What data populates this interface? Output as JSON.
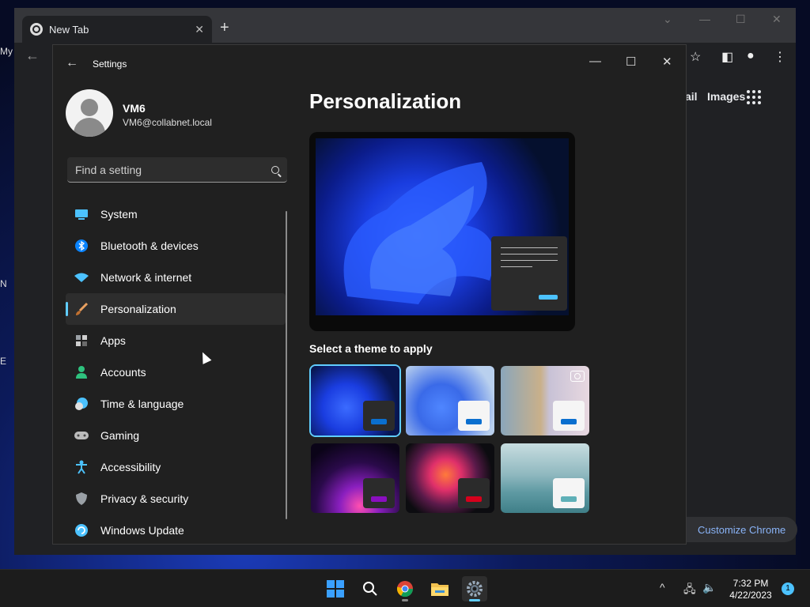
{
  "desktop": {
    "fragments": [
      "My",
      "N",
      "E"
    ]
  },
  "chrome": {
    "tab_title": "New Tab",
    "tab_close": "✕",
    "new_tab": "+",
    "window_controls": [
      "⌄",
      "—",
      "☐",
      "✕"
    ],
    "back": "←",
    "links": [
      "ail",
      "Images"
    ],
    "customize_label": "Customize Chrome"
  },
  "settings": {
    "window_title": "Settings",
    "back": "←",
    "controls": {
      "minimize": "—",
      "maximize": "☐",
      "close": "✕"
    },
    "user": {
      "name": "VM6",
      "email": "VM6@collabnet.local"
    },
    "search_placeholder": "Find a setting",
    "nav": [
      {
        "label": "System",
        "icon": "system-icon",
        "color": "#4cc2ff"
      },
      {
        "label": "Bluetooth & devices",
        "icon": "bluetooth-icon",
        "color": "#0a84ff"
      },
      {
        "label": "Network & internet",
        "icon": "wifi-icon",
        "color": "#4cc2ff"
      },
      {
        "label": "Personalization",
        "icon": "brush-icon",
        "color": "#e8a060",
        "active": true
      },
      {
        "label": "Apps",
        "icon": "apps-icon",
        "color": "#9aa0a6"
      },
      {
        "label": "Accounts",
        "icon": "account-icon",
        "color": "#2ec27e"
      },
      {
        "label": "Time & language",
        "icon": "clock-globe-icon",
        "color": "#4cc2ff"
      },
      {
        "label": "Gaming",
        "icon": "gamepad-icon",
        "color": "#bbbbbb"
      },
      {
        "label": "Accessibility",
        "icon": "accessibility-icon",
        "color": "#4cc2ff"
      },
      {
        "label": "Privacy & security",
        "icon": "shield-icon",
        "color": "#9aa0a6"
      },
      {
        "label": "Windows Update",
        "icon": "update-icon",
        "color": "#4cc2ff"
      }
    ],
    "page_title": "Personalization",
    "themes_label": "Select a theme to apply",
    "themes": [
      {
        "name": "windows-dark",
        "accent": "#0a6fcf",
        "selected": true
      },
      {
        "name": "windows-light",
        "accent": "#0a6fcf"
      },
      {
        "name": "windows-spotlight",
        "accent": "#0a6fcf"
      },
      {
        "name": "glow",
        "accent": "#8a0fbf"
      },
      {
        "name": "captured-motion",
        "accent": "#d6001c"
      },
      {
        "name": "flow",
        "accent": "#5fb0b8"
      }
    ]
  },
  "taskbar": {
    "apps": [
      "start-button",
      "search-button",
      "chrome-app",
      "file-explorer-app",
      "settings-app"
    ],
    "tray_chevron": "^",
    "time": "7:32 PM",
    "date": "4/22/2023",
    "notifications": "1"
  },
  "colors": {
    "accent": "#60cdff",
    "window_bg": "#202020",
    "chrome_bg": "#202124"
  }
}
